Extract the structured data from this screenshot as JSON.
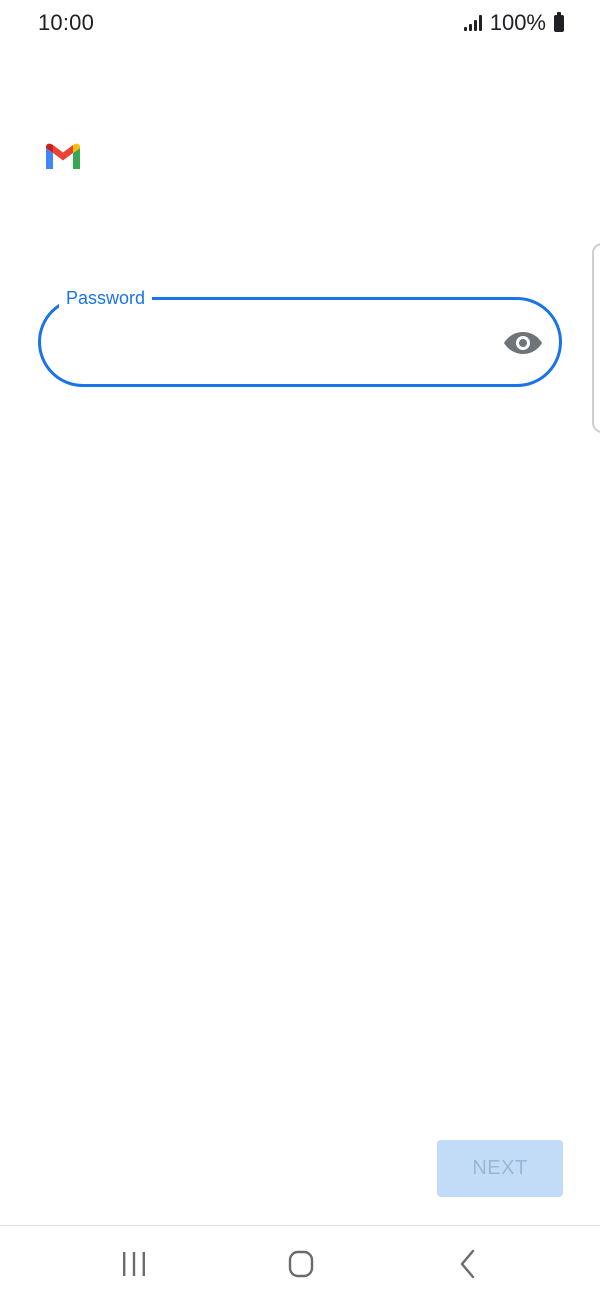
{
  "status_bar": {
    "time": "10:00",
    "battery": "100%"
  },
  "app": {
    "logo_icon": "gmail-logo",
    "colors": {
      "accent": "#1a73e8",
      "next_disabled_bg": "#c2dcf8",
      "next_disabled_text": "#9ab6d6"
    }
  },
  "password_field": {
    "label": "Password",
    "value": "",
    "toggle_icon": "eye-icon"
  },
  "actions": {
    "next_label": "NEXT"
  },
  "navigation": {
    "recent_icon": "recent-apps-icon",
    "home_icon": "home-icon",
    "back_icon": "back-icon"
  }
}
